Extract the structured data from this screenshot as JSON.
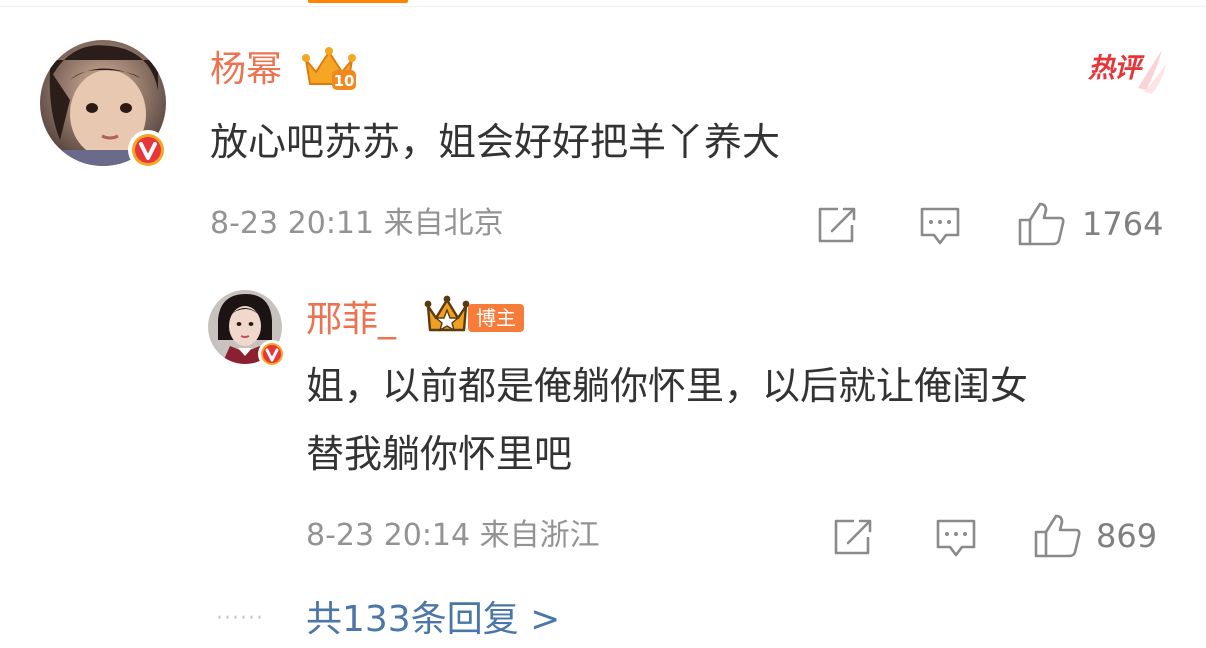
{
  "comment": {
    "username": "杨幂",
    "hot_label": "热评",
    "text": "放心吧苏苏，姐会好好把羊丫养大",
    "date": "8-23",
    "time": "20:11",
    "location": "来自北京",
    "likes": "1764",
    "icons": [
      "share-icon",
      "reply-icon",
      "thumbs-up-icon",
      "crown-level-icon",
      "verified-v-icon"
    ]
  },
  "reply": {
    "username": "邢菲_",
    "badge": "博主",
    "text_line1": "姐，以前都是俺躺你怀里，以后就让俺闺女",
    "text_line2": "替我躺你怀里吧",
    "date": "8-23",
    "time": "20:14",
    "location": "来自浙江",
    "likes": "869"
  },
  "more": {
    "dots": "······",
    "label": "共133条回复 >"
  },
  "colors": {
    "username": "#eb7350",
    "body_text": "#333333",
    "meta_text": "#939393",
    "link": "#4a77a8",
    "hot": "#e8353a",
    "accent": "#ff8200",
    "verified": "#f5a623"
  }
}
